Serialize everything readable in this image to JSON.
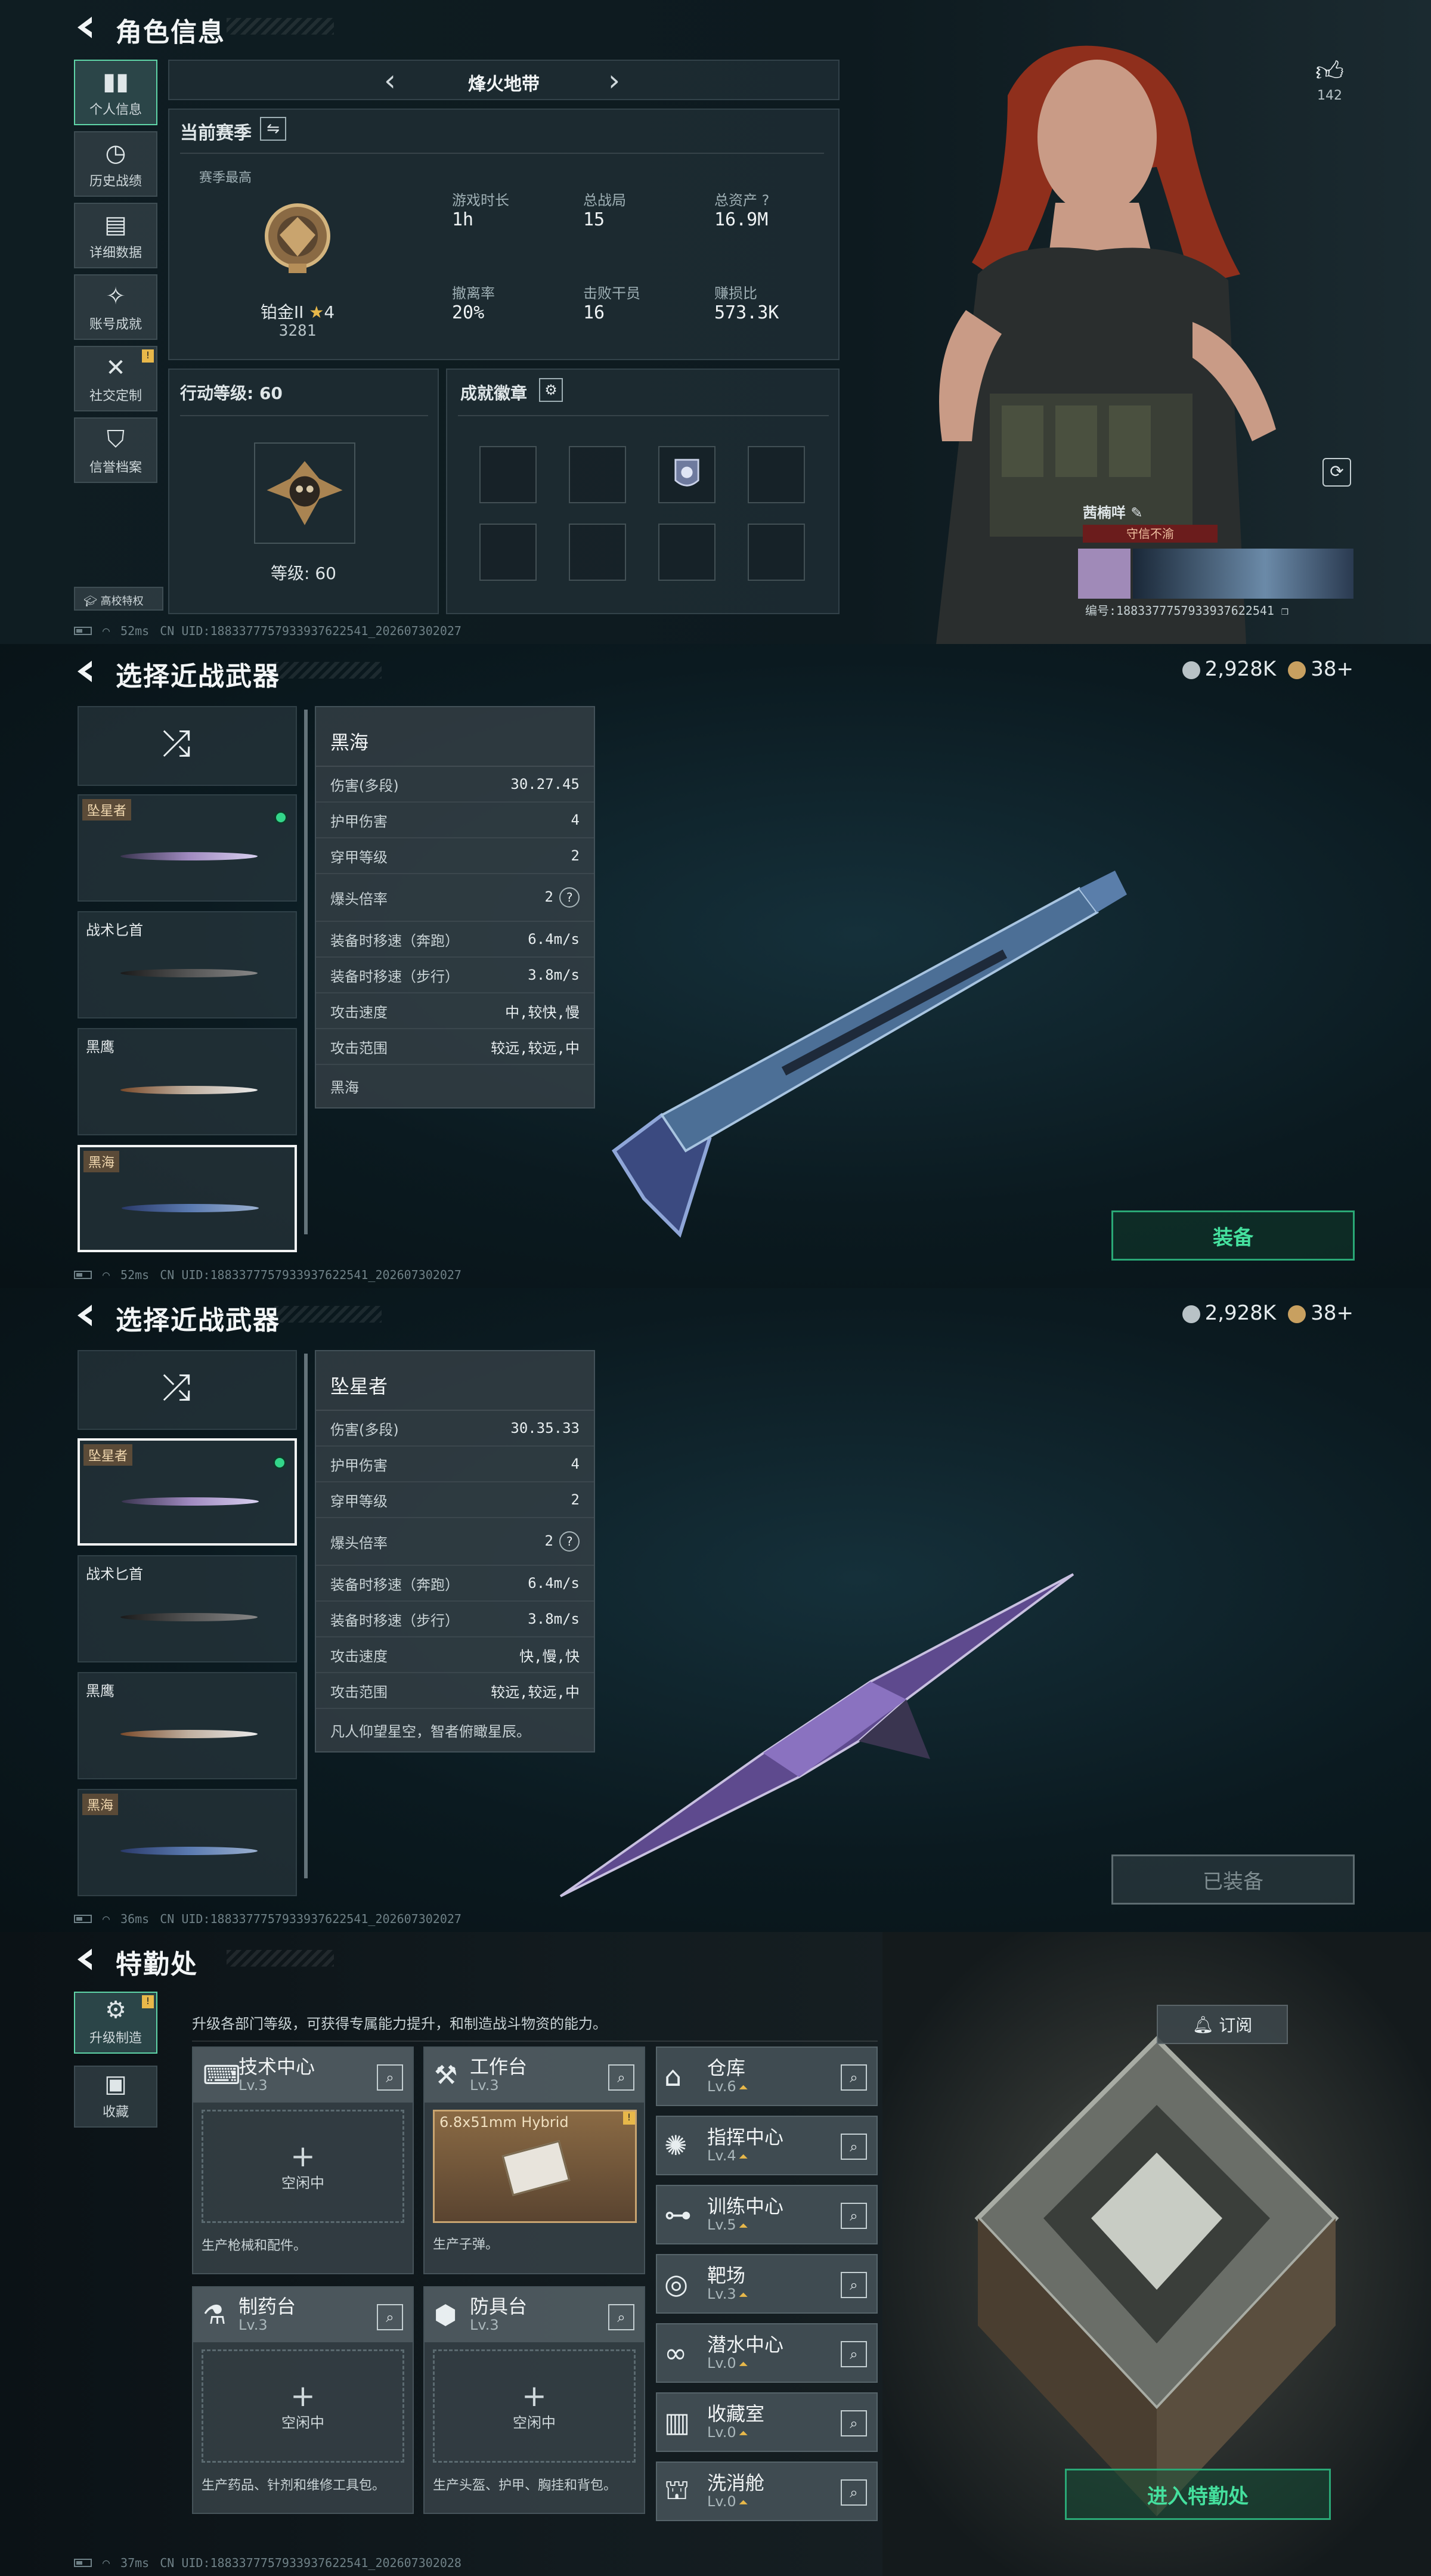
{
  "colors": {
    "accent_green": "#45e09e",
    "gold": "#e8b84a",
    "bg": "#0b1418"
  },
  "profile": {
    "title": "角色信息",
    "map_name": "烽火地带",
    "season_label": "当前赛季",
    "season_best": "赛季最高",
    "rank_name": "铂金II",
    "rank_stars": "4",
    "rank_score": "3281",
    "stats": [
      {
        "label": "游戏时长",
        "value": "1h"
      },
      {
        "label": "总战局",
        "value": "15"
      },
      {
        "label": "总资产",
        "value": "16.9M"
      },
      {
        "label": "撤离率",
        "value": "20%"
      },
      {
        "label": "击败干员",
        "value": "16"
      },
      {
        "label": "赚损比",
        "value": "573.3K"
      }
    ],
    "action_level_label": "行动等级: 60",
    "level_text": "等级: 60",
    "badges_label": "成就徽章",
    "sidebar": [
      {
        "label": "个人信息",
        "icon": "bar-chart-icon"
      },
      {
        "label": "历史战绩",
        "icon": "history-icon"
      },
      {
        "label": "详细数据",
        "icon": "folder-icon"
      },
      {
        "label": "账号成就",
        "icon": "badge-icon"
      },
      {
        "label": "社交定制",
        "icon": "tools-icon"
      },
      {
        "label": "信誉档案",
        "icon": "shield-icon"
      }
    ],
    "campus_label": "高校特权",
    "likes": "142",
    "player_name": "茜楠咩",
    "player_tag": "守信不渝",
    "player_id": "编号:1883377757933937622541",
    "footer": {
      "ping": "52ms",
      "uid": "CN UID:1883377757933937622541_202607302027"
    }
  },
  "melee1": {
    "title": "选择近战武器",
    "currency_a": "2,928K",
    "currency_b": "38+",
    "weapons": [
      {
        "name": "坠星者",
        "tagged": true
      },
      {
        "name": "战术匕首",
        "tagged": false
      },
      {
        "name": "黑鹰",
        "tagged": false
      },
      {
        "name": "黑海",
        "tagged": true
      }
    ],
    "detail_name": "黑海",
    "rows": [
      {
        "k": "伤害(多段)",
        "v": "30.27.45"
      },
      {
        "k": "护甲伤害",
        "v": "4"
      },
      {
        "k": "穿甲等级",
        "v": "2"
      },
      {
        "k": "爆头倍率",
        "v": "2"
      },
      {
        "k": "装备时移速（奔跑）",
        "v": "6.4m/s"
      },
      {
        "k": "装备时移速（步行）",
        "v": "3.8m/s"
      },
      {
        "k": "攻击速度",
        "v": "中,较快,慢"
      },
      {
        "k": "攻击范围",
        "v": "较远,较远,中"
      }
    ],
    "desc": "黑海",
    "button": "装备",
    "footer": {
      "ping": "52ms",
      "uid": "CN UID:1883377757933937622541_202607302027"
    }
  },
  "melee2": {
    "title": "选择近战武器",
    "currency_a": "2,928K",
    "currency_b": "38+",
    "weapons": [
      {
        "name": "坠星者",
        "tagged": true
      },
      {
        "name": "战术匕首",
        "tagged": false
      },
      {
        "name": "黑鹰",
        "tagged": false
      },
      {
        "name": "黑海",
        "tagged": true
      }
    ],
    "detail_name": "坠星者",
    "rows": [
      {
        "k": "伤害(多段)",
        "v": "30.35.33"
      },
      {
        "k": "护甲伤害",
        "v": "4"
      },
      {
        "k": "穿甲等级",
        "v": "2"
      },
      {
        "k": "爆头倍率",
        "v": "2"
      },
      {
        "k": "装备时移速（奔跑）",
        "v": "6.4m/s"
      },
      {
        "k": "装备时移速（步行）",
        "v": "3.8m/s"
      },
      {
        "k": "攻击速度",
        "v": "快,慢,快"
      },
      {
        "k": "攻击范围",
        "v": "较远,较远,中"
      }
    ],
    "desc": "凡人仰望星空，智者俯瞰星辰。",
    "button": "已装备",
    "footer": {
      "ping": "36ms",
      "uid": "CN UID:1883377757933937622541_202607302027"
    }
  },
  "ops": {
    "title": "特勤处",
    "subtitle": "升级各部门等级，可获得专属能力提升，和制造战斗物资的能力。",
    "side": [
      {
        "label": "升级制造",
        "icon": "gear-icon"
      },
      {
        "label": "收藏",
        "icon": "collection-icon"
      }
    ],
    "subscribe": "订阅",
    "cards": [
      {
        "name": "技术中心",
        "lv": "Lv.3",
        "desc": "生产枪械和配件。",
        "empty": "空闲中",
        "icon": "computer-icon"
      },
      {
        "name": "工作台",
        "lv": "Lv.3",
        "desc": "生产子弹。",
        "item": "6.8x51mm Hybrid",
        "icon": "hammer-icon"
      },
      {
        "name": "制药台",
        "lv": "Lv.3",
        "desc": "生产药品、针剂和维修工具包。",
        "empty": "空闲中",
        "icon": "flask-icon"
      },
      {
        "name": "防具台",
        "lv": "Lv.3",
        "desc": "生产头盔、护甲、胸挂和背包。",
        "empty": "空闲中",
        "icon": "boxes-icon"
      }
    ],
    "facilities": [
      {
        "name": "仓库",
        "lv": "Lv.6",
        "icon": "warehouse-icon"
      },
      {
        "name": "指挥中心",
        "lv": "Lv.4",
        "icon": "command-icon"
      },
      {
        "name": "训练中心",
        "lv": "Lv.5",
        "icon": "dumbbell-icon"
      },
      {
        "name": "靶场",
        "lv": "Lv.3",
        "icon": "target-icon"
      },
      {
        "name": "潜水中心",
        "lv": "Lv.0",
        "icon": "goggles-icon"
      },
      {
        "name": "收藏室",
        "lv": "Lv.0",
        "icon": "vault-icon"
      },
      {
        "name": "洗消舱",
        "lv": "Lv.0",
        "icon": "chamber-icon"
      }
    ],
    "enter": "进入特勤处",
    "footer": {
      "ping": "37ms",
      "uid": "CN UID:1883377757933937622541_202607302028"
    }
  }
}
